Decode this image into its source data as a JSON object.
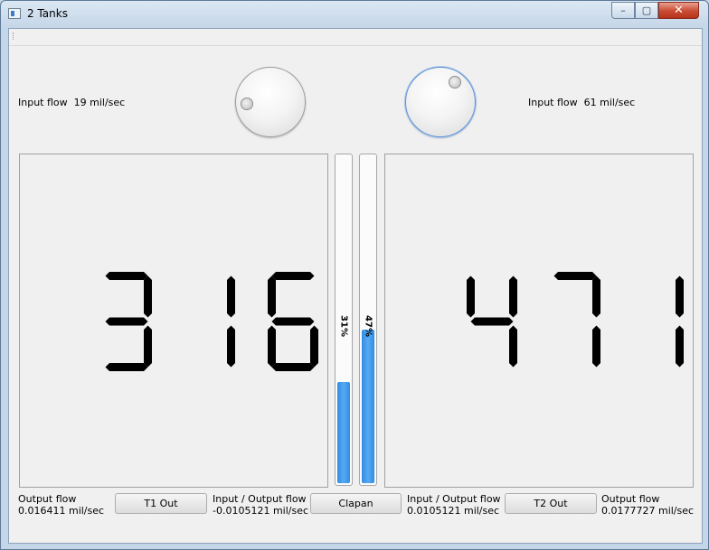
{
  "window": {
    "title": "2 Tanks",
    "controls": {
      "minimize": "–",
      "maximize": "▢",
      "close": "✕"
    }
  },
  "tank1": {
    "input_flow_label": "Input flow",
    "input_flow_value": "19 mil/sec",
    "display_digits": "316",
    "level_percent_text": "31%",
    "level_fraction": 0.31,
    "output_flow_label": "Output flow",
    "output_flow_value": "0.016411 mil/sec",
    "out_button": "T1 Out",
    "io_label": "Input / Output flow",
    "io_value": "-0.0105121 mil/sec"
  },
  "tank2": {
    "input_flow_label": "Input flow",
    "input_flow_value": "61 mil/sec",
    "display_digits": "471",
    "level_percent_text": "47%",
    "level_fraction": 0.47,
    "output_flow_label": "Output flow",
    "output_flow_value": "0.0177727 mil/sec",
    "out_button": "T2 Out",
    "io_label": "Input / Output flow",
    "io_value": "0.0105121 mil/sec"
  },
  "clapan_button": "Clapan",
  "colors": {
    "bar_fill": "#3b96ea",
    "lcd_segment": "#000000"
  }
}
